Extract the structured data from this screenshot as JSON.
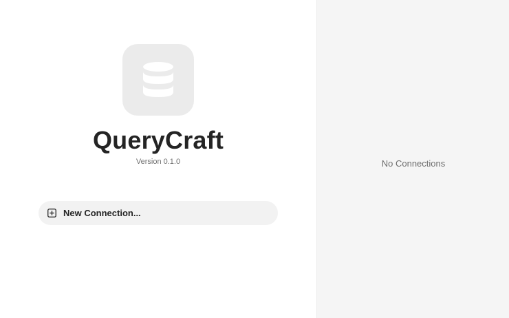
{
  "window": {
    "close_button": "close-button"
  },
  "welcome": {
    "app_icon": "database-icon",
    "app_name": "QueryCraft",
    "version_label": "Version 0.1.0",
    "new_connection": {
      "icon": "plus-square-icon",
      "label": "New Connection..."
    }
  },
  "connections": {
    "empty_label": "No Connections"
  },
  "colors": {
    "background": "#ffffff",
    "sidebar_background": "#f5f5f5",
    "icon_tile": "#ebebeb",
    "button_background": "#f2f2f2",
    "text_primary": "#242424",
    "text_secondary": "#6e6e6e"
  }
}
